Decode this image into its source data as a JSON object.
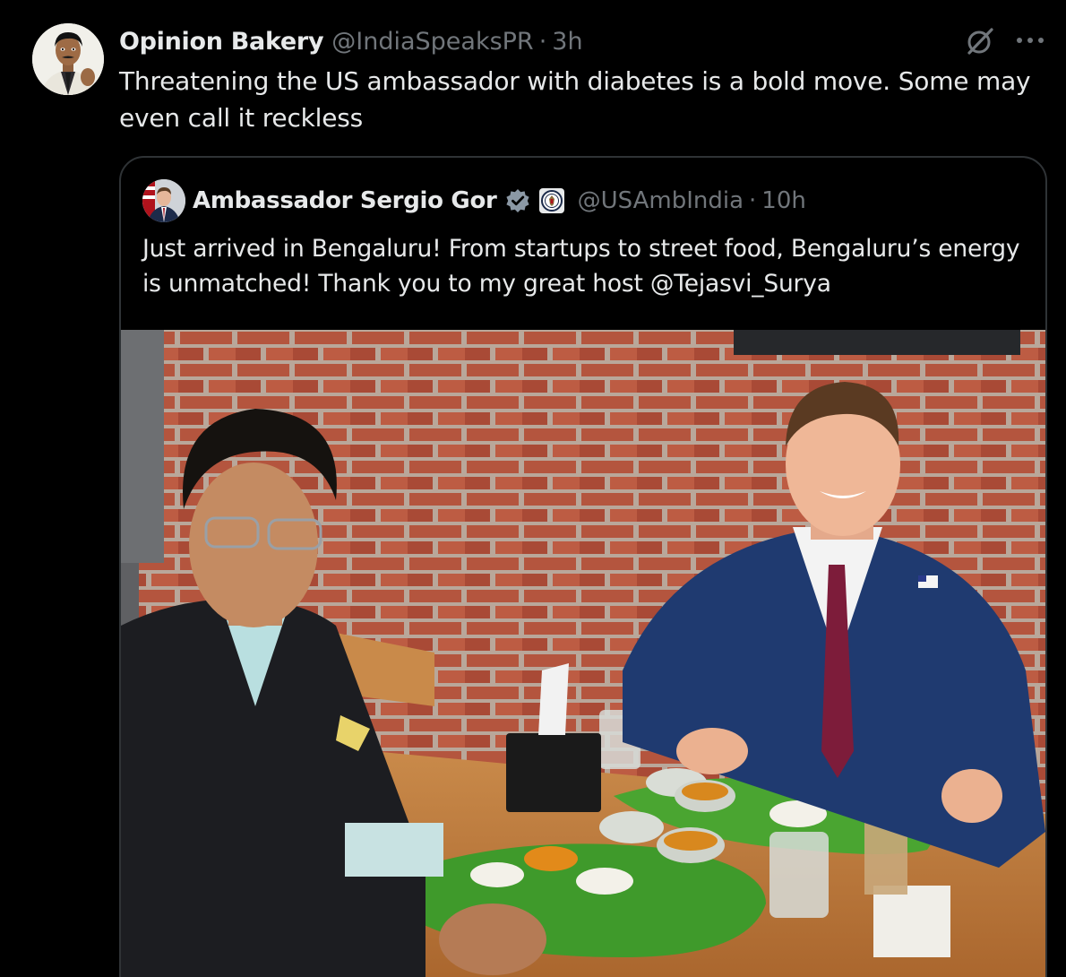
{
  "tweet": {
    "display_name": "Opinion Bakery",
    "handle": "@IndiaSpeaksPR",
    "separator": "·",
    "time": "3h",
    "text": "Threatening the US ambassador with diabetes is a bold move. Some may even call it reckless",
    "avatar_icon": "user-avatar",
    "actions": {
      "grok_icon": "grok-icon",
      "more_icon": "more-horizontal-icon"
    }
  },
  "quoted_tweet": {
    "display_name": "Ambassador Sergio Gor",
    "verified_icon": "verified-badge-icon",
    "affiliation_icon": "government-seal-icon",
    "handle": "@USAmbIndia",
    "separator": "·",
    "time": "10h",
    "text": "Just arrived in Bengaluru! From startups to street food, Bengaluru’s energy is unmatched! Thank you to my great host @Tejasvi_Surya",
    "photo_icon": "attached-photo"
  },
  "colors": {
    "background": "#000000",
    "text_primary": "#e7e9ea",
    "text_secondary": "#71767b",
    "border": "#2f3336",
    "verified": "#1d9bf0"
  }
}
